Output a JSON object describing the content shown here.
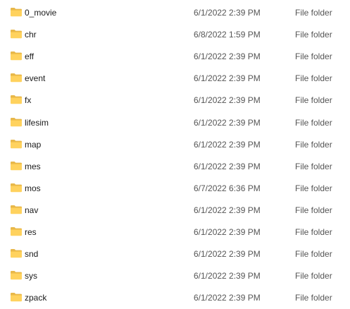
{
  "folder_icon": "folder-icon",
  "colors": {
    "folder_back": "#e8b84a",
    "folder_front": "#ffd25e",
    "text": "#1a1a1a",
    "muted_text": "#555555"
  },
  "files": [
    {
      "name": "0_movie",
      "date": "6/1/2022 2:39 PM",
      "type": "File folder"
    },
    {
      "name": "chr",
      "date": "6/8/2022 1:59 PM",
      "type": "File folder"
    },
    {
      "name": "eff",
      "date": "6/1/2022 2:39 PM",
      "type": "File folder"
    },
    {
      "name": "event",
      "date": "6/1/2022 2:39 PM",
      "type": "File folder"
    },
    {
      "name": "fx",
      "date": "6/1/2022 2:39 PM",
      "type": "File folder"
    },
    {
      "name": "lifesim",
      "date": "6/1/2022 2:39 PM",
      "type": "File folder"
    },
    {
      "name": "map",
      "date": "6/1/2022 2:39 PM",
      "type": "File folder"
    },
    {
      "name": "mes",
      "date": "6/1/2022 2:39 PM",
      "type": "File folder"
    },
    {
      "name": "mos",
      "date": "6/7/2022 6:36 PM",
      "type": "File folder"
    },
    {
      "name": "nav",
      "date": "6/1/2022 2:39 PM",
      "type": "File folder"
    },
    {
      "name": "res",
      "date": "6/1/2022 2:39 PM",
      "type": "File folder"
    },
    {
      "name": "snd",
      "date": "6/1/2022 2:39 PM",
      "type": "File folder"
    },
    {
      "name": "sys",
      "date": "6/1/2022 2:39 PM",
      "type": "File folder"
    },
    {
      "name": "zpack",
      "date": "6/1/2022 2:39 PM",
      "type": "File folder"
    }
  ]
}
